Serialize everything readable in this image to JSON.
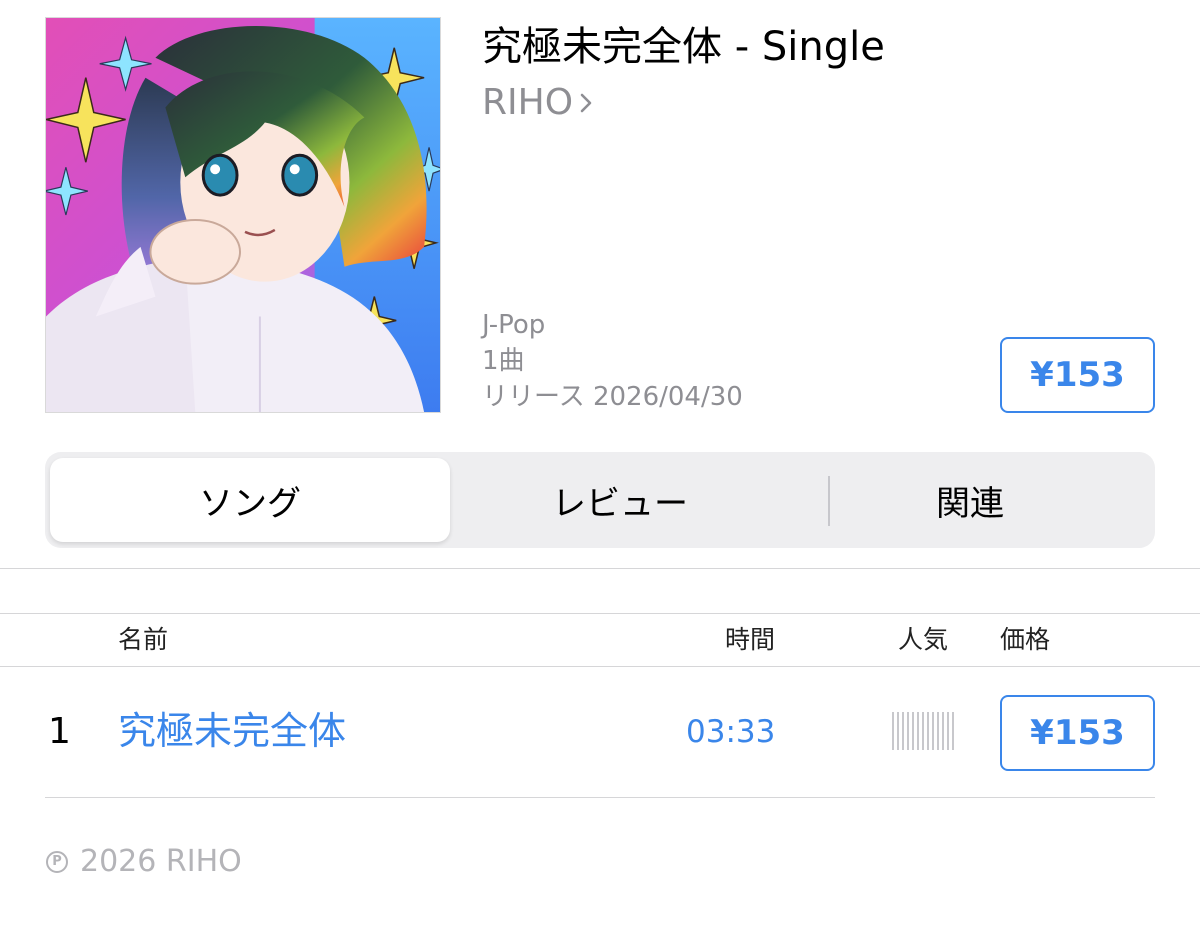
{
  "album": {
    "title": "究極未完全体 - Single",
    "artist": "RIHO",
    "genre": "J-Pop",
    "track_count": "1曲",
    "release": "リリース 2026/04/30",
    "price": "¥153"
  },
  "tabs": [
    {
      "label": "ソング",
      "selected": true
    },
    {
      "label": "レビュー",
      "selected": false
    },
    {
      "label": "関連",
      "selected": false
    }
  ],
  "table": {
    "headers": {
      "name": "名前",
      "time": "時間",
      "popularity": "人気",
      "price": "価格"
    },
    "rows": [
      {
        "number": "1",
        "name": "究極未完全体",
        "time": "03:33",
        "popularity": 0,
        "price": "¥153"
      }
    ]
  },
  "footer": {
    "copyright_symbol": "P",
    "copyright_text": "2026 RIHO"
  },
  "colors": {
    "accent": "#3a86ea",
    "secondary_text": "#8e8e93",
    "segment_bg": "#eeeef0"
  },
  "icons": {
    "artist_chevron": "chevron-right-icon",
    "popularity": "popularity-bars-icon",
    "copyright": "phonogram-copyright-icon"
  }
}
